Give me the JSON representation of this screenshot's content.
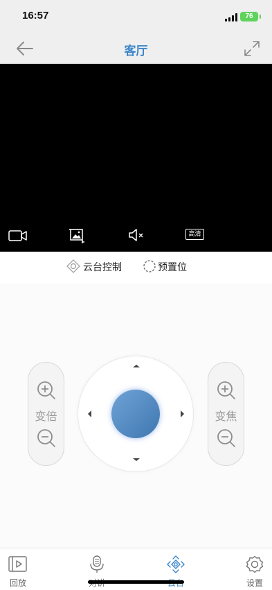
{
  "status_bar": {
    "time": "16:57",
    "battery": "76"
  },
  "nav": {
    "title": "客厅"
  },
  "video_toolbar": {
    "record_icon": "video-record-icon",
    "screenshot_icon": "screenshot-icon",
    "mute_icon": "speaker-muted-icon",
    "quality_label": "高清"
  },
  "tabs": [
    {
      "label": "云台控制",
      "icon": "ptz-icon",
      "active": true
    },
    {
      "label": "预置位",
      "icon": "preset-icon",
      "active": false
    }
  ],
  "ptz": {
    "zoom_label": "变倍",
    "focus_label": "变焦"
  },
  "bottom_tabs": [
    {
      "label": "回放",
      "icon": "playback-icon"
    },
    {
      "label": "对讲",
      "icon": "microphone-icon"
    },
    {
      "label": "云台",
      "icon": "ptz-icon",
      "active": true
    },
    {
      "label": "设置",
      "icon": "settings-icon"
    }
  ],
  "colors": {
    "accent": "#3b86c9",
    "tab_active_underline": "#4e8a6a",
    "tab_inactive_underline": "#d6d6d6",
    "video_bg": "#000000"
  }
}
